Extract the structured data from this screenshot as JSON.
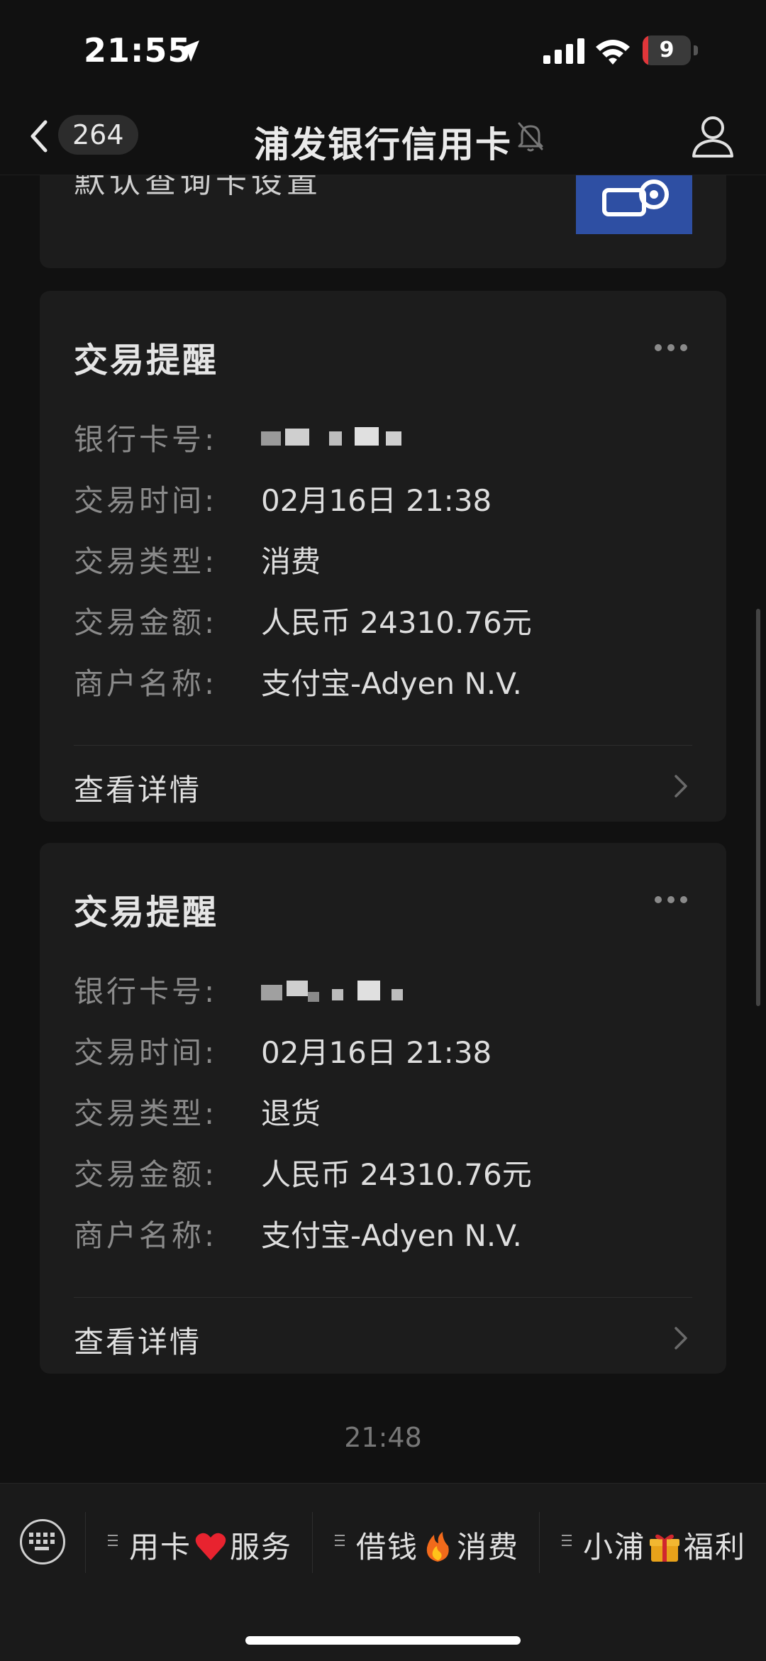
{
  "status_bar": {
    "time": "21:55",
    "battery": "9",
    "battery_level": 0.09
  },
  "nav": {
    "unread_count": "264",
    "title": "浦发银行信用卡"
  },
  "partial_card": {
    "text": "默认查询卡设置"
  },
  "cards": [
    {
      "title": "交易提醒",
      "rows": [
        {
          "label": "银行卡号:",
          "value": ""
        },
        {
          "label": "交易时间:",
          "value": "02月16日 21:38"
        },
        {
          "label": "交易类型:",
          "value": "消费"
        },
        {
          "label": "交易金额:",
          "value": "人民币 24310.76元"
        },
        {
          "label": "商户名称:",
          "value": "支付宝-Adyen N.V."
        }
      ],
      "detail_label": "查看详情"
    },
    {
      "title": "交易提醒",
      "rows": [
        {
          "label": "银行卡号:",
          "value": ""
        },
        {
          "label": "交易时间:",
          "value": "02月16日 21:38"
        },
        {
          "label": "交易类型:",
          "value": "退货"
        },
        {
          "label": "交易金额:",
          "value": "人民币 24310.76元"
        },
        {
          "label": "商户名称:",
          "value": "支付宝-Adyen N.V."
        }
      ],
      "detail_label": "查看详情"
    }
  ],
  "timestamp": "21:48",
  "menu": [
    {
      "left": "用卡",
      "emoji": "heart-icon",
      "right": "服务"
    },
    {
      "left": "借钱",
      "emoji": "fire-icon",
      "right": "消费"
    },
    {
      "left": "小浦",
      "emoji": "gift-icon",
      "right": "福利"
    }
  ],
  "colors": {
    "background": "#111111",
    "card": "#1c1c1c",
    "accent_blue": "#2e4fa3",
    "battery_red": "#e0363a"
  }
}
